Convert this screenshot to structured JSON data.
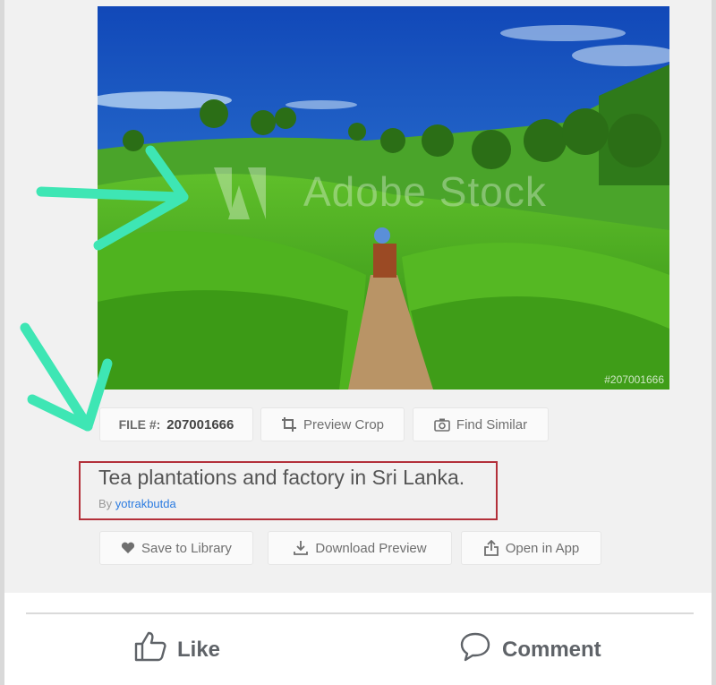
{
  "photo": {
    "watermark": "Adobe Stock",
    "stock_id": "#207001666"
  },
  "file": {
    "label": "FILE #:",
    "number": "207001666"
  },
  "actions_top": {
    "preview_crop": "Preview Crop",
    "find_similar": "Find Similar"
  },
  "asset": {
    "title": "Tea plantations and factory in Sri Lanka.",
    "by": "By",
    "author": "yotrakbutda"
  },
  "actions_bottom": {
    "save_library": "Save to Library",
    "download_preview": "Download Preview",
    "open_in_app": "Open in App"
  },
  "footer": {
    "like": "Like",
    "comment": "Comment"
  },
  "colors": {
    "annotation_arrow": "#3ee6b4",
    "highlight_box": "#b3303a",
    "author_link": "#2b7be0"
  },
  "icons": [
    "crop-icon",
    "camera-icon",
    "heart-icon",
    "download-icon",
    "share-icon",
    "thumbs-up-icon",
    "comment-icon",
    "adobe-logo"
  ]
}
